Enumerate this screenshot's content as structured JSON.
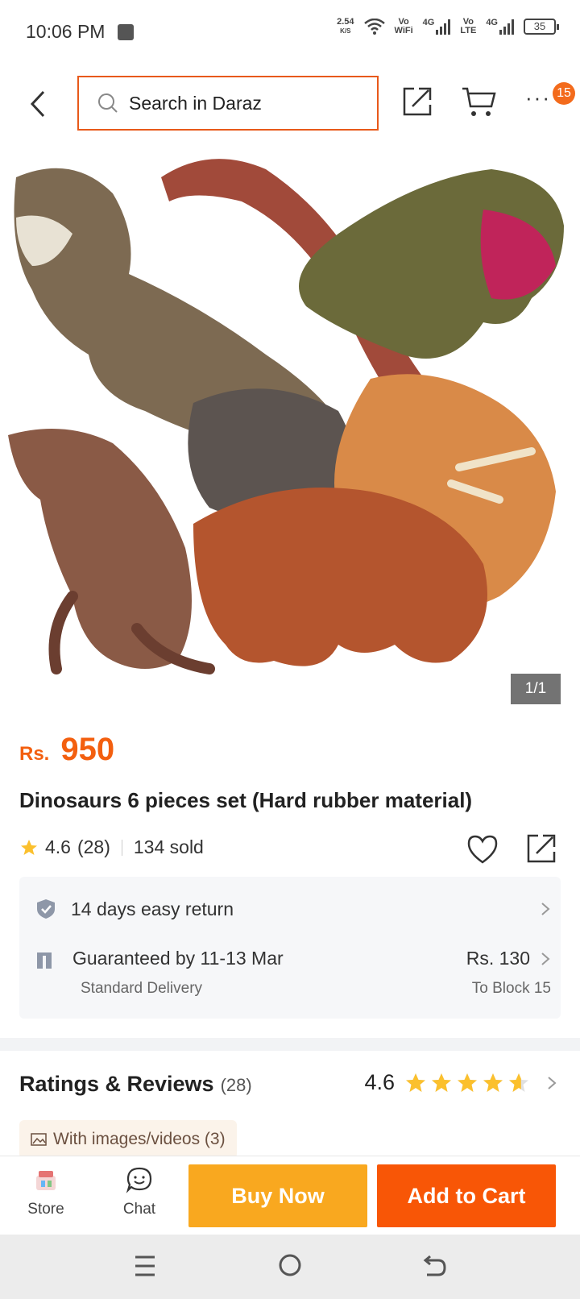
{
  "status_bar": {
    "time": "10:06 PM",
    "speed_value": "2.54",
    "speed_unit": "K/S",
    "wifi_label_top": "Vo",
    "wifi_label_bottom": "WiFi",
    "net1": "4G",
    "lte_label_top": "Vo",
    "lte_label_bottom": "LTE",
    "net2": "4G",
    "battery": "35"
  },
  "header": {
    "search_placeholder": "Search in Daraz",
    "cart_badge": "15",
    "more_label": "···"
  },
  "product": {
    "image_counter": "1/1",
    "price_currency": "Rs.",
    "price_value": "950",
    "title": "Dinosaurs 6 pieces set (Hard rubber material)",
    "rating": "4.6",
    "rating_count": "(28)",
    "sold": "134 sold"
  },
  "service": {
    "return_text": "14 days easy return",
    "delivery_text": "Guaranteed by 11-13 Mar",
    "delivery_type": "Standard Delivery",
    "delivery_fee": "Rs. 130",
    "delivery_dest": "To Block 15"
  },
  "reviews": {
    "title": "Ratings & Reviews",
    "count": "(28)",
    "score": "4.6",
    "stars": 4.6,
    "chip": "With images/videos (3)"
  },
  "actions": {
    "store": "Store",
    "chat": "Chat",
    "buy_now": "Buy Now",
    "add_to_cart": "Add to Cart"
  },
  "colors": {
    "accent": "#f85606",
    "buy_now": "#f9a81f",
    "star": "#fbc02d"
  }
}
